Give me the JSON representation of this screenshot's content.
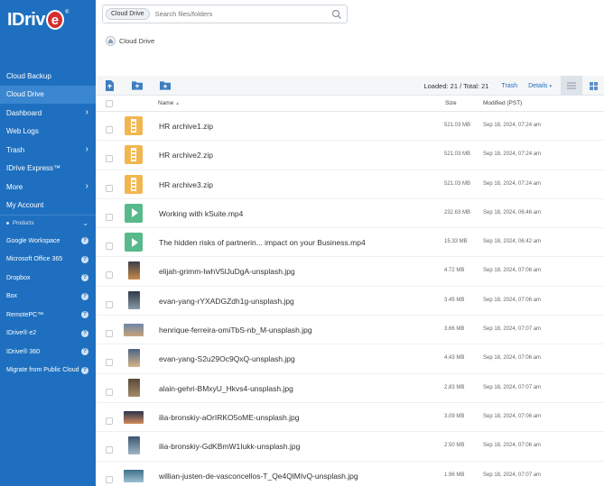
{
  "app": {
    "logo_text": "IDriv",
    "logo_e": "e",
    "logo_reg": "®"
  },
  "sidebar": {
    "items": [
      {
        "label": "Cloud Backup",
        "chevron": false,
        "active": false
      },
      {
        "label": "Cloud Drive",
        "chevron": false,
        "active": true
      },
      {
        "label": "Dashboard",
        "chevron": true,
        "active": false
      },
      {
        "label": "Web Logs",
        "chevron": false,
        "active": false
      },
      {
        "label": "Trash",
        "chevron": true,
        "active": false
      },
      {
        "label": "IDrive Express™",
        "chevron": false,
        "active": false
      },
      {
        "label": "More",
        "chevron": true,
        "active": false
      },
      {
        "label": "My Account",
        "chevron": false,
        "active": false
      }
    ],
    "products_label": "Products",
    "products": [
      {
        "label": "Google Workspace"
      },
      {
        "label": "Microsoft Office 365"
      },
      {
        "label": "Dropbox"
      },
      {
        "label": "Box"
      },
      {
        "label": "RemotePC™"
      },
      {
        "label": "IDrive® e2"
      },
      {
        "label": "IDrive® 360"
      },
      {
        "label": "Migrate from Public Cloud"
      }
    ]
  },
  "search": {
    "scope": "Cloud Drive",
    "placeholder": "Search files/folders"
  },
  "breadcrumb": {
    "current": "Cloud Drive"
  },
  "toolbar": {
    "loaded_text": "Loaded: 21 / Total: 21",
    "trash_label": "Trash",
    "details_label": "Details"
  },
  "table": {
    "headers": {
      "name": "Name",
      "size": "Size",
      "modified": "Modified (PST)"
    },
    "rows": [
      {
        "name": "HR archive1.zip",
        "size": "521.03 MB",
        "modified": "Sep 18, 2024, 07:24 am",
        "type": "zip"
      },
      {
        "name": "HR archive2.zip",
        "size": "521.03 MB",
        "modified": "Sep 18, 2024, 07:24 am",
        "type": "zip"
      },
      {
        "name": "HR archive3.zip",
        "size": "521.03 MB",
        "modified": "Sep 18, 2024, 07:24 am",
        "type": "zip"
      },
      {
        "name": "Working with kSuite.mp4",
        "size": "232.63 MB",
        "modified": "Sep 18, 2024, 06:46 am",
        "type": "video"
      },
      {
        "name": "The hidden risks of partnerin... impact on your Business.mp4",
        "size": "15.33 MB",
        "modified": "Sep 18, 2024, 06:42 am",
        "type": "video"
      },
      {
        "name": "elijah-grimm-IwhV5lJuDgA-unsplash.jpg",
        "size": "4.72 MB",
        "modified": "Sep 18, 2024, 07:06 am",
        "type": "image",
        "thumb": [
          "#3b3f4a",
          "#c98a4a"
        ],
        "portrait": true
      },
      {
        "name": "evan-yang-rYXADGZdh1g-unsplash.jpg",
        "size": "3.45 MB",
        "modified": "Sep 18, 2024, 07:06 am",
        "type": "image",
        "thumb": [
          "#2f3a48",
          "#8a9aa8"
        ],
        "portrait": true
      },
      {
        "name": "henrique-ferreira-omiTbS-nb_M-unsplash.jpg",
        "size": "3.66 MB",
        "modified": "Sep 18, 2024, 07:07 am",
        "type": "image",
        "thumb": [
          "#6d86a6",
          "#c7a27a"
        ],
        "portrait": false
      },
      {
        "name": "evan-yang-S2u29Oc9QxQ-unsplash.jpg",
        "size": "4.43 MB",
        "modified": "Sep 18, 2024, 07:06 am",
        "type": "image",
        "thumb": [
          "#4b6482",
          "#d6b48a"
        ],
        "portrait": true
      },
      {
        "name": "alain-gehri-BMxyU_Hkvs4-unsplash.jpg",
        "size": "2.83 MB",
        "modified": "Sep 18, 2024, 07:07 am",
        "type": "image",
        "thumb": [
          "#5a4a3a",
          "#a58a6a"
        ],
        "portrait": true
      },
      {
        "name": "ilia-bronskiy-aOrIRKO5oME-unsplash.jpg",
        "size": "3.09 MB",
        "modified": "Sep 18, 2024, 07:06 am",
        "type": "image",
        "thumb": [
          "#2a3350",
          "#d08a5a"
        ],
        "portrait": false
      },
      {
        "name": "ilia-bronskiy-GdKBmW1Iukk-unsplash.jpg",
        "size": "2.50 MB",
        "modified": "Sep 18, 2024, 07:06 am",
        "type": "image",
        "thumb": [
          "#3d5670",
          "#9fb4c4"
        ],
        "portrait": true
      },
      {
        "name": "willian-justen-de-vasconcellos-T_Qe4QlMIvQ-unsplash.jpg",
        "size": "1.96 MB",
        "modified": "Sep 18, 2024, 07:07 am",
        "type": "image",
        "thumb": [
          "#3f6e8a",
          "#9bc0d0"
        ],
        "portrait": false
      }
    ]
  },
  "colors": {
    "sidebar_bg": "#1e6fbf",
    "sidebar_active": "#3a86d0",
    "link": "#1e6fbf",
    "zip": "#f2b651",
    "video": "#58b98b"
  }
}
